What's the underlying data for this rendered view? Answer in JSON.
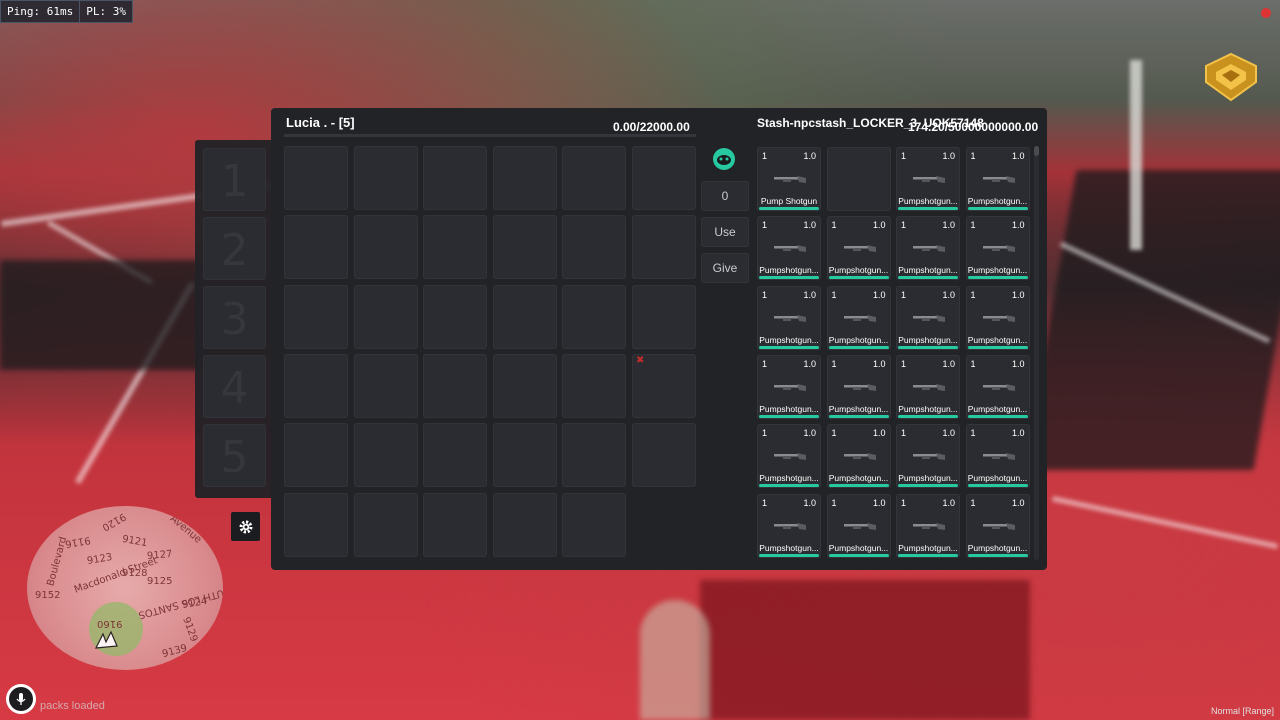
{
  "hud": {
    "ping": "Ping: 61ms",
    "packet_loss": "PL: 3%",
    "status_text": "packs loaded",
    "voice_mode": "Normal [Range]"
  },
  "player_inventory": {
    "title": "Lucia . - [5]",
    "weight": "0.00/22000.00",
    "hotbar_numbers": [
      "1",
      "2",
      "3",
      "4",
      "5"
    ]
  },
  "actions": {
    "amount": "0",
    "use": "Use",
    "give": "Give"
  },
  "stash": {
    "title": "Stash-npcstash_LOCKER_3_UOK57148",
    "weight": "174.20/50000000000.00",
    "items": [
      {
        "count": "1",
        "weight": "1.0",
        "name": "Pump Shotgun",
        "empty": false
      },
      {
        "count": "",
        "weight": "",
        "name": "",
        "empty": true
      },
      {
        "count": "1",
        "weight": "1.0",
        "name": "Pumpshotgun...",
        "empty": false
      },
      {
        "count": "1",
        "weight": "1.0",
        "name": "Pumpshotgun...",
        "empty": false
      },
      {
        "count": "1",
        "weight": "1.0",
        "name": "Pumpshotgun...",
        "empty": false
      },
      {
        "count": "1",
        "weight": "1.0",
        "name": "Pumpshotgun...",
        "empty": false
      },
      {
        "count": "1",
        "weight": "1.0",
        "name": "Pumpshotgun...",
        "empty": false
      },
      {
        "count": "1",
        "weight": "1.0",
        "name": "Pumpshotgun...",
        "empty": false
      },
      {
        "count": "1",
        "weight": "1.0",
        "name": "Pumpshotgun...",
        "empty": false
      },
      {
        "count": "1",
        "weight": "1.0",
        "name": "Pumpshotgun...",
        "empty": false
      },
      {
        "count": "1",
        "weight": "1.0",
        "name": "Pumpshotgun...",
        "empty": false
      },
      {
        "count": "1",
        "weight": "1.0",
        "name": "Pumpshotgun...",
        "empty": false
      },
      {
        "count": "1",
        "weight": "1.0",
        "name": "Pumpshotgun...",
        "empty": false
      },
      {
        "count": "1",
        "weight": "1.0",
        "name": "Pumpshotgun...",
        "empty": false
      },
      {
        "count": "1",
        "weight": "1.0",
        "name": "Pumpshotgun...",
        "empty": false
      },
      {
        "count": "1",
        "weight": "1.0",
        "name": "Pumpshotgun...",
        "empty": false
      },
      {
        "count": "1",
        "weight": "1.0",
        "name": "Pumpshotgun...",
        "empty": false
      },
      {
        "count": "1",
        "weight": "1.0",
        "name": "Pumpshotgun...",
        "empty": false
      },
      {
        "count": "1",
        "weight": "1.0",
        "name": "Pumpshotgun...",
        "empty": false
      },
      {
        "count": "1",
        "weight": "1.0",
        "name": "Pumpshotgun...",
        "empty": false
      },
      {
        "count": "1",
        "weight": "1.0",
        "name": "Pumpshotgun...",
        "empty": false
      },
      {
        "count": "1",
        "weight": "1.0",
        "name": "Pumpshotgun...",
        "empty": false
      },
      {
        "count": "1",
        "weight": "1.0",
        "name": "Pumpshotgun...",
        "empty": false
      },
      {
        "count": "1",
        "weight": "1.0",
        "name": "Pumpshotgun...",
        "empty": false
      }
    ]
  },
  "minimap": {
    "labels": [
      "9120",
      "9116",
      "Avenue",
      "9121",
      "9127",
      "9123",
      "9128",
      "9125",
      "9124",
      "9152",
      "9129",
      "9160",
      "9139",
      "Macdonald Street",
      "Boulevard",
      "UTH LOS SANTOS"
    ]
  },
  "colors": {
    "accent": "#27c9a0",
    "panel": "#222327",
    "slot": "#2b2c31"
  }
}
